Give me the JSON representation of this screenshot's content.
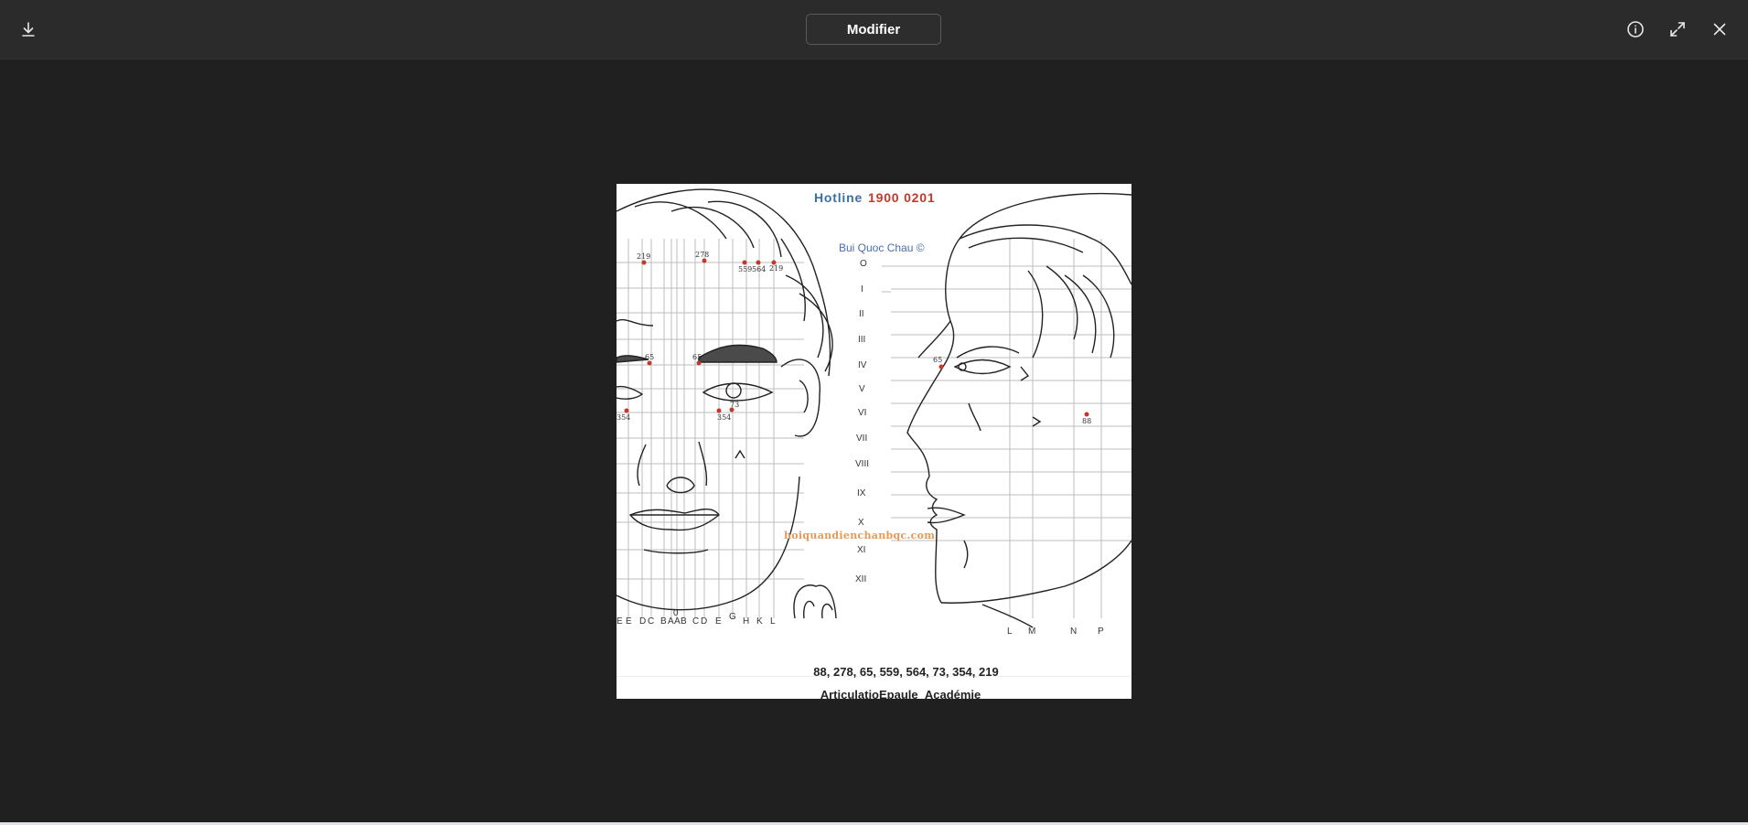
{
  "toolbar": {
    "edit_label": "Modifier",
    "icons": {
      "download": "download-icon",
      "info": "info-icon",
      "fullscreen": "expand-icon",
      "close": "close-icon"
    }
  },
  "image": {
    "hotline_label": "Hotline",
    "hotline_number": "1900 0201",
    "author": "Bui Quoc Chau ©",
    "website": "hoiquandienchanbqc.com",
    "points": "88, 278, 65, 559, 564, 73, 354, 219",
    "caption": "ArticulatioEpaule_Académie",
    "row_labels": [
      "O",
      "I",
      "II",
      "III",
      "IV",
      "V",
      "VI",
      "VII",
      "VIII",
      "IX",
      "X",
      "XI",
      "XII"
    ],
    "front_columns": [
      "E",
      "D",
      "C",
      "B",
      "A",
      "A",
      "B",
      "C",
      "D",
      "E",
      "G",
      "H",
      "K",
      "L"
    ],
    "front_zero": "0",
    "side_columns": [
      "L",
      "M",
      "N",
      "P"
    ],
    "point_labels": [
      "219",
      "278",
      "559",
      "564",
      "219",
      "65",
      "65",
      "354",
      "354",
      "73",
      "65",
      "88"
    ]
  }
}
